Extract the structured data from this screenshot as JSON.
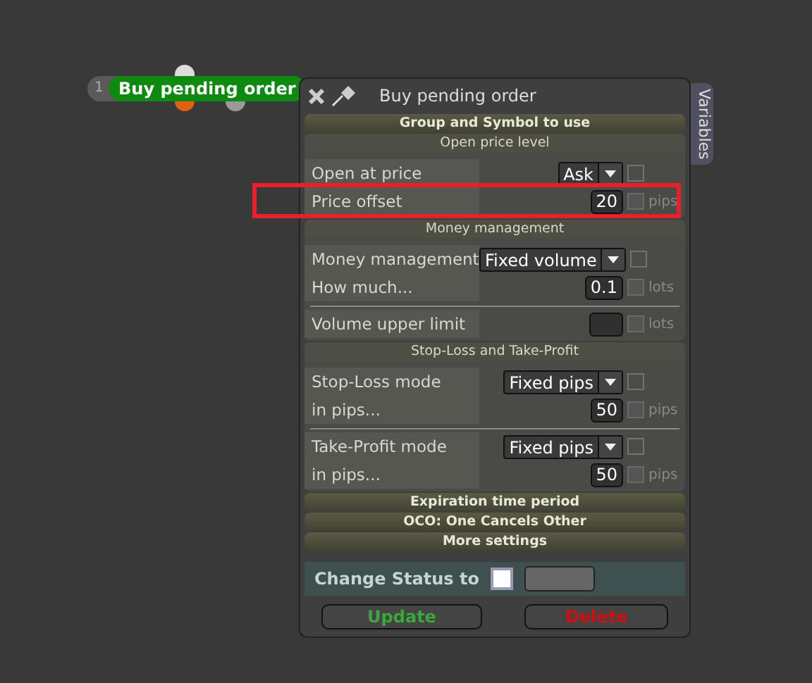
{
  "node": {
    "number": "1",
    "title": "Buy pending order"
  },
  "panel": {
    "title": "Buy pending order",
    "side_tab": "Variables"
  },
  "sections": [
    {
      "kind": "collapsed",
      "title": "Group and Symbol to use"
    },
    {
      "kind": "group",
      "title": "Open price level",
      "blocks": [
        [
          {
            "kind": "select",
            "label": "Open at price",
            "value": "Ask",
            "checked": false
          },
          {
            "kind": "number",
            "label": "Price offset",
            "value": "20",
            "checked": false,
            "unit": "pips"
          }
        ]
      ]
    },
    {
      "kind": "group",
      "title": "Money management",
      "blocks": [
        [
          {
            "kind": "select",
            "label": "Money management",
            "value": "Fixed volume",
            "checked": false
          },
          {
            "kind": "number",
            "label": "How much...",
            "value": "0.1",
            "checked": false,
            "unit": "lots"
          }
        ],
        [
          {
            "kind": "number",
            "label": "Volume upper limit",
            "checked": false,
            "unit": "lots"
          }
        ]
      ]
    },
    {
      "kind": "group",
      "title": "Stop-Loss and Take-Profit",
      "blocks": [
        [
          {
            "kind": "select",
            "label": "Stop-Loss mode",
            "value": "Fixed pips",
            "checked": false
          },
          {
            "kind": "number",
            "label": "in pips...",
            "value": "50",
            "checked": false,
            "unit": "pips"
          }
        ],
        [
          {
            "kind": "select",
            "label": "Take-Profit mode",
            "value": "Fixed pips",
            "checked": false
          },
          {
            "kind": "number",
            "label": "in pips...",
            "value": "50",
            "checked": false,
            "unit": "pips"
          }
        ]
      ]
    },
    {
      "kind": "collapsed",
      "title": "Expiration time period"
    },
    {
      "kind": "collapsed",
      "title": "OCO: One Cancels Other"
    },
    {
      "kind": "collapsed",
      "title": "More settings"
    }
  ],
  "status": {
    "label": "Change Status to",
    "checked": false
  },
  "buttons": [
    {
      "label": "Update",
      "color": "#3aa83a"
    },
    {
      "label": "Delete",
      "color": "#d01010"
    }
  ]
}
